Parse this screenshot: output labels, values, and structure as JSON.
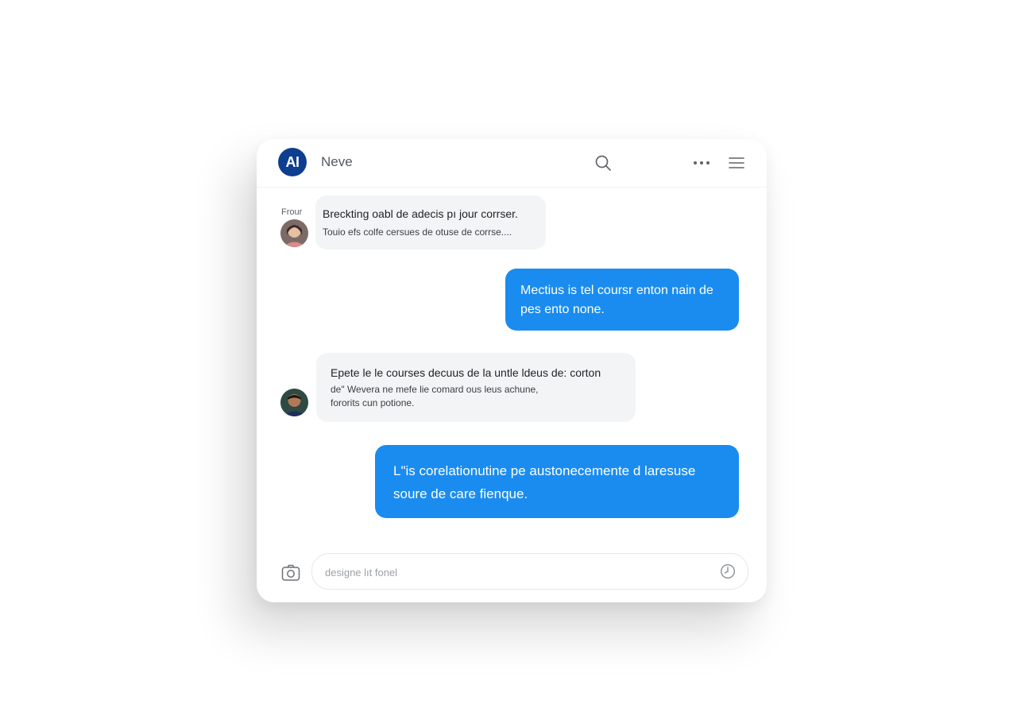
{
  "header": {
    "logo_text": "AI",
    "title": "Neve",
    "icons": [
      "search-icon",
      "more-icon",
      "menu-icon"
    ]
  },
  "messages": [
    {
      "direction": "incoming",
      "sender": "Frour",
      "lines": [
        "Breckting oabl de adecis pı jour corrser.",
        "Touio efs colfe cersues de otuse de corrse...."
      ]
    },
    {
      "direction": "outgoing",
      "lines": [
        "Mectius is tel coursr enton nain de",
        "pes ento none."
      ]
    },
    {
      "direction": "incoming",
      "sender": "",
      "lines": [
        "Epete le le courses decuus de la untle ldeus de: corton",
        "de\" Wevera ne mefe lie comard ous leus achune,",
        "fororits cun potione."
      ]
    },
    {
      "direction": "outgoing",
      "lines": [
        "L\"is corelationutine pe austonecemente d laresuse",
        "soure de care fienque."
      ]
    }
  ],
  "composer": {
    "placeholder": "designe lıt fonel",
    "icons": [
      "camera-icon",
      "clock-icon"
    ]
  },
  "colors": {
    "brand": "#0e3e8f",
    "outgoing_bubble": "#1a8cf0",
    "incoming_bubble": "#f3f4f5"
  }
}
